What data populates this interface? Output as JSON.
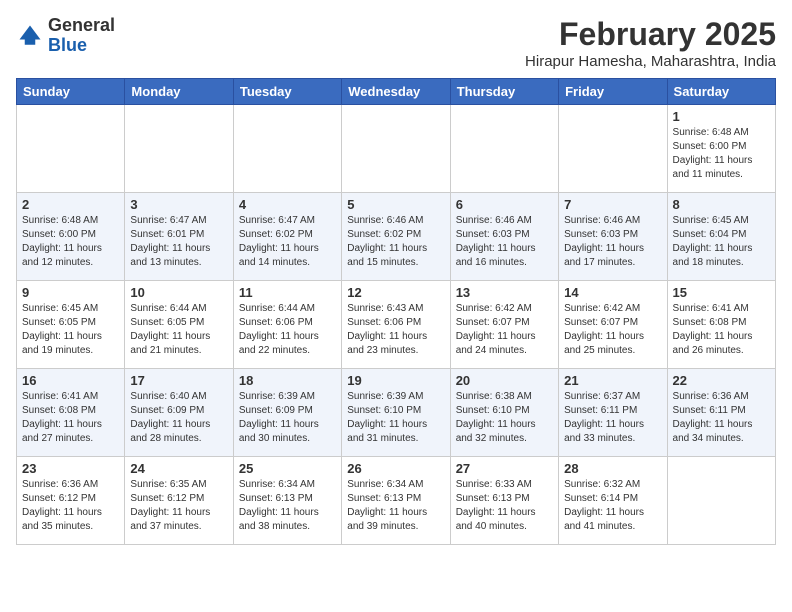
{
  "header": {
    "logo_general": "General",
    "logo_blue": "Blue",
    "month_title": "February 2025",
    "location": "Hirapur Hamesha, Maharashtra, India"
  },
  "weekdays": [
    "Sunday",
    "Monday",
    "Tuesday",
    "Wednesday",
    "Thursday",
    "Friday",
    "Saturday"
  ],
  "weeks": [
    [
      {
        "day": "",
        "info": ""
      },
      {
        "day": "",
        "info": ""
      },
      {
        "day": "",
        "info": ""
      },
      {
        "day": "",
        "info": ""
      },
      {
        "day": "",
        "info": ""
      },
      {
        "day": "",
        "info": ""
      },
      {
        "day": "1",
        "info": "Sunrise: 6:48 AM\nSunset: 6:00 PM\nDaylight: 11 hours\nand 11 minutes."
      }
    ],
    [
      {
        "day": "2",
        "info": "Sunrise: 6:48 AM\nSunset: 6:00 PM\nDaylight: 11 hours\nand 12 minutes."
      },
      {
        "day": "3",
        "info": "Sunrise: 6:47 AM\nSunset: 6:01 PM\nDaylight: 11 hours\nand 13 minutes."
      },
      {
        "day": "4",
        "info": "Sunrise: 6:47 AM\nSunset: 6:02 PM\nDaylight: 11 hours\nand 14 minutes."
      },
      {
        "day": "5",
        "info": "Sunrise: 6:46 AM\nSunset: 6:02 PM\nDaylight: 11 hours\nand 15 minutes."
      },
      {
        "day": "6",
        "info": "Sunrise: 6:46 AM\nSunset: 6:03 PM\nDaylight: 11 hours\nand 16 minutes."
      },
      {
        "day": "7",
        "info": "Sunrise: 6:46 AM\nSunset: 6:03 PM\nDaylight: 11 hours\nand 17 minutes."
      },
      {
        "day": "8",
        "info": "Sunrise: 6:45 AM\nSunset: 6:04 PM\nDaylight: 11 hours\nand 18 minutes."
      }
    ],
    [
      {
        "day": "9",
        "info": "Sunrise: 6:45 AM\nSunset: 6:05 PM\nDaylight: 11 hours\nand 19 minutes."
      },
      {
        "day": "10",
        "info": "Sunrise: 6:44 AM\nSunset: 6:05 PM\nDaylight: 11 hours\nand 21 minutes."
      },
      {
        "day": "11",
        "info": "Sunrise: 6:44 AM\nSunset: 6:06 PM\nDaylight: 11 hours\nand 22 minutes."
      },
      {
        "day": "12",
        "info": "Sunrise: 6:43 AM\nSunset: 6:06 PM\nDaylight: 11 hours\nand 23 minutes."
      },
      {
        "day": "13",
        "info": "Sunrise: 6:42 AM\nSunset: 6:07 PM\nDaylight: 11 hours\nand 24 minutes."
      },
      {
        "day": "14",
        "info": "Sunrise: 6:42 AM\nSunset: 6:07 PM\nDaylight: 11 hours\nand 25 minutes."
      },
      {
        "day": "15",
        "info": "Sunrise: 6:41 AM\nSunset: 6:08 PM\nDaylight: 11 hours\nand 26 minutes."
      }
    ],
    [
      {
        "day": "16",
        "info": "Sunrise: 6:41 AM\nSunset: 6:08 PM\nDaylight: 11 hours\nand 27 minutes."
      },
      {
        "day": "17",
        "info": "Sunrise: 6:40 AM\nSunset: 6:09 PM\nDaylight: 11 hours\nand 28 minutes."
      },
      {
        "day": "18",
        "info": "Sunrise: 6:39 AM\nSunset: 6:09 PM\nDaylight: 11 hours\nand 30 minutes."
      },
      {
        "day": "19",
        "info": "Sunrise: 6:39 AM\nSunset: 6:10 PM\nDaylight: 11 hours\nand 31 minutes."
      },
      {
        "day": "20",
        "info": "Sunrise: 6:38 AM\nSunset: 6:10 PM\nDaylight: 11 hours\nand 32 minutes."
      },
      {
        "day": "21",
        "info": "Sunrise: 6:37 AM\nSunset: 6:11 PM\nDaylight: 11 hours\nand 33 minutes."
      },
      {
        "day": "22",
        "info": "Sunrise: 6:36 AM\nSunset: 6:11 PM\nDaylight: 11 hours\nand 34 minutes."
      }
    ],
    [
      {
        "day": "23",
        "info": "Sunrise: 6:36 AM\nSunset: 6:12 PM\nDaylight: 11 hours\nand 35 minutes."
      },
      {
        "day": "24",
        "info": "Sunrise: 6:35 AM\nSunset: 6:12 PM\nDaylight: 11 hours\nand 37 minutes."
      },
      {
        "day": "25",
        "info": "Sunrise: 6:34 AM\nSunset: 6:13 PM\nDaylight: 11 hours\nand 38 minutes."
      },
      {
        "day": "26",
        "info": "Sunrise: 6:34 AM\nSunset: 6:13 PM\nDaylight: 11 hours\nand 39 minutes."
      },
      {
        "day": "27",
        "info": "Sunrise: 6:33 AM\nSunset: 6:13 PM\nDaylight: 11 hours\nand 40 minutes."
      },
      {
        "day": "28",
        "info": "Sunrise: 6:32 AM\nSunset: 6:14 PM\nDaylight: 11 hours\nand 41 minutes."
      },
      {
        "day": "",
        "info": ""
      }
    ]
  ]
}
